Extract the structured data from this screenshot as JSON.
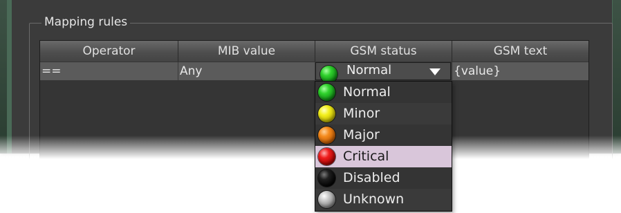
{
  "group": {
    "title": "Mapping rules"
  },
  "table": {
    "columns": [
      "Operator",
      "MIB value",
      "GSM status",
      "GSM text"
    ],
    "rows": [
      {
        "operator": "==",
        "mib_value": "Any",
        "gsm_status": "Normal",
        "gsm_text": "{value}"
      }
    ]
  },
  "dropdown": {
    "options": [
      {
        "label": "Normal",
        "icon": "green-led-icon",
        "color": "#2fd12c",
        "selected": false
      },
      {
        "label": "Minor",
        "icon": "yellow-led-icon",
        "color": "#f3ef1c",
        "selected": false
      },
      {
        "label": "Major",
        "icon": "orange-led-icon",
        "color": "#f48a1c",
        "selected": false
      },
      {
        "label": "Critical",
        "icon": "red-led-icon",
        "color": "#ee1d1d",
        "selected": true
      },
      {
        "label": "Disabled",
        "icon": "black-led-icon",
        "color": "#000000",
        "selected": false
      },
      {
        "label": "Unknown",
        "icon": "gray-led-icon",
        "color": "#c8c8c8",
        "selected": false
      }
    ]
  }
}
